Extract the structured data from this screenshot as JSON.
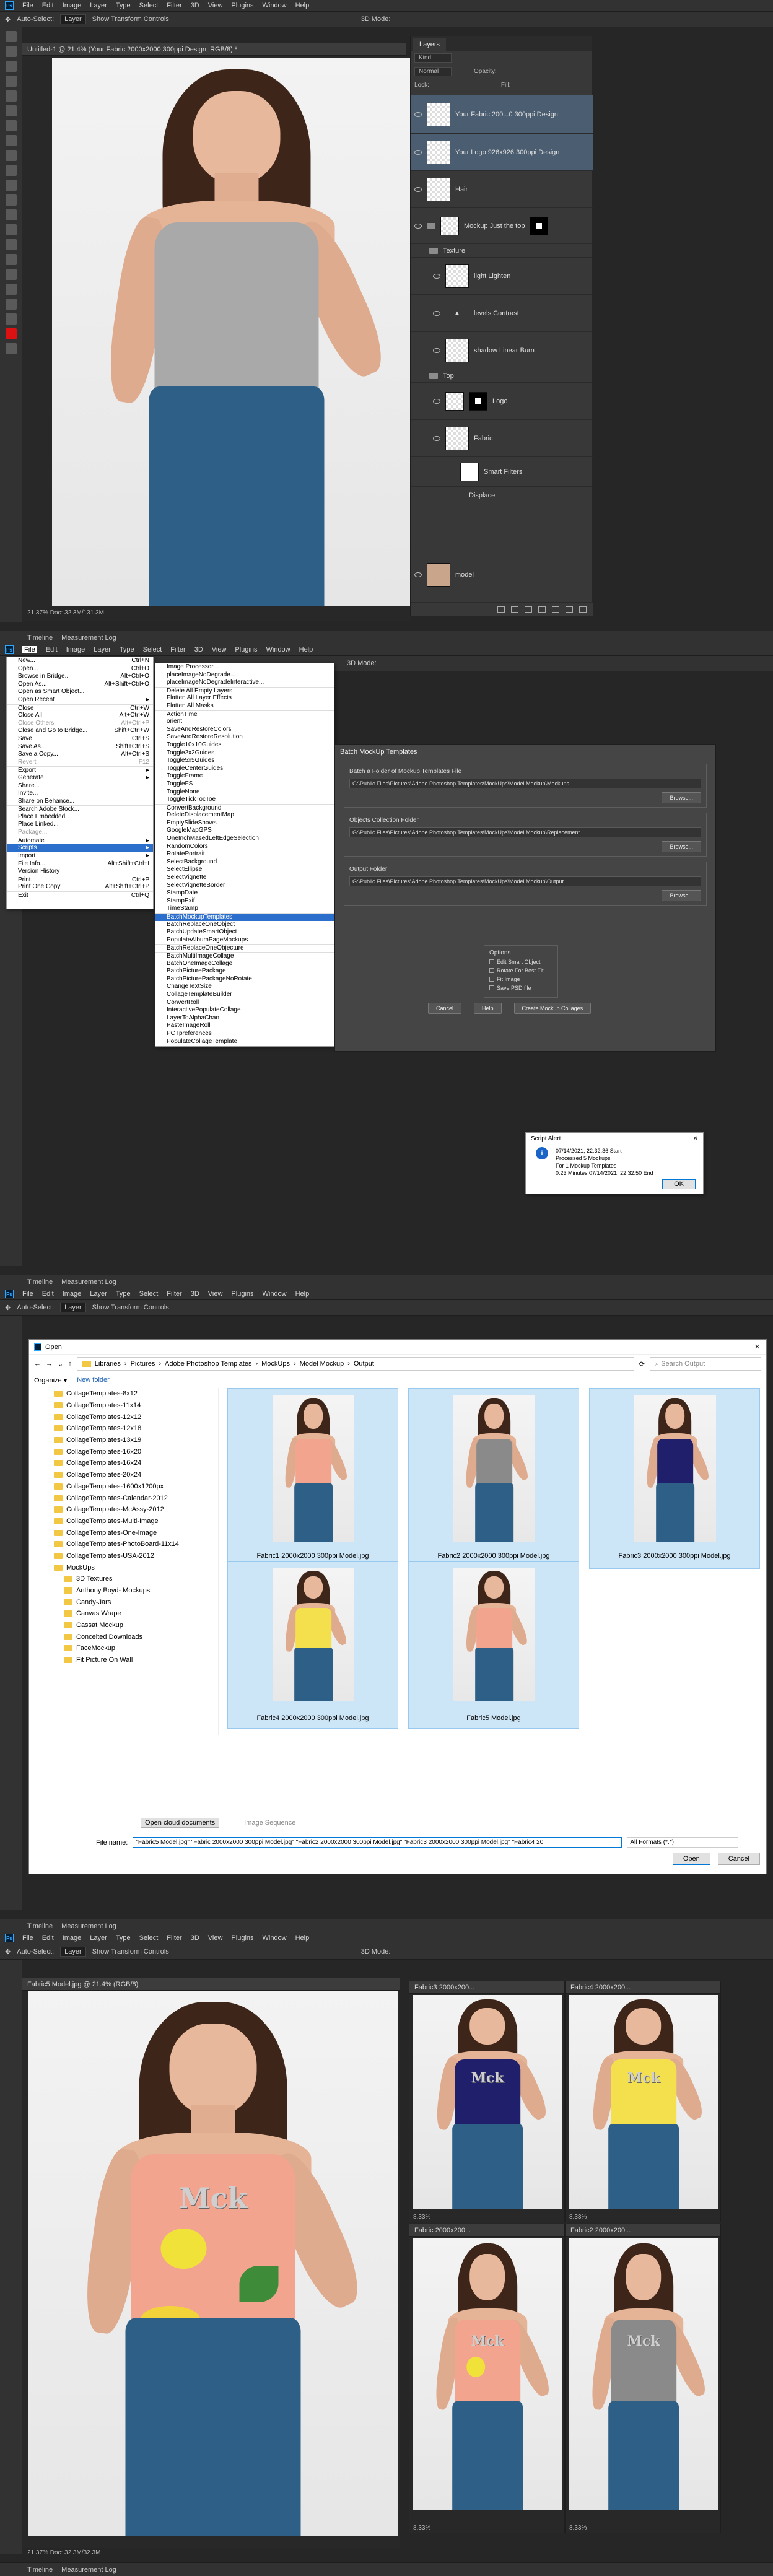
{
  "menubar": {
    "items": [
      "File",
      "Edit",
      "Image",
      "Layer",
      "Type",
      "Select",
      "Filter",
      "3D",
      "View",
      "Plugins",
      "Window",
      "Help"
    ]
  },
  "optbar": {
    "auto_select": "Auto-Select:",
    "auto_value": "Layer",
    "transform": "Show Transform Controls",
    "mode3d": "3D Mode:"
  },
  "timeline": {
    "tab1": "Timeline",
    "tab2": "Measurement Log"
  },
  "panel1": {
    "doc_title": "Untitled-1 @ 21.4% (Your Fabric 2000x2000 300ppi Design, RGB/8) *",
    "status": "21.37%     Doc: 32.3M/131.3M",
    "top_color": "#a9a9a9",
    "layers": {
      "tab": "Layers",
      "kind": "Kind",
      "blend": "Normal",
      "opacity_label": "Opacity:",
      "lock_label": "Lock:",
      "fill_label": "Fill:",
      "items": [
        {
          "name": "Your Fabric 200...0 300ppi Design"
        },
        {
          "name": "Your Logo 926x926 300ppi Design"
        },
        {
          "name": "Hair"
        },
        {
          "name": "Mockup  Just the top"
        },
        {
          "name": "Texture"
        },
        {
          "name": "light Lighten"
        },
        {
          "name": "levels Contrast"
        },
        {
          "name": "shadow Linear Burn"
        },
        {
          "name": "Top"
        },
        {
          "name": "Logo"
        },
        {
          "name": "Fabric"
        },
        {
          "name": "Smart Filters"
        },
        {
          "name": "Displace"
        },
        {
          "name": "model"
        }
      ]
    }
  },
  "panel2": {
    "file_menu": [
      {
        "label": "New...",
        "key": "Ctrl+N"
      },
      {
        "label": "Open...",
        "key": "Ctrl+O"
      },
      {
        "label": "Browse in Bridge...",
        "key": "Alt+Ctrl+O"
      },
      {
        "label": "Open As...",
        "key": "Alt+Shift+Ctrl+O"
      },
      {
        "label": "Open as Smart Object...",
        "key": ""
      },
      {
        "label": "Open Recent",
        "key": "▸"
      },
      {
        "label": "Close",
        "key": "Ctrl+W"
      },
      {
        "label": "Close All",
        "key": "Alt+Ctrl+W"
      },
      {
        "label": "Close Others",
        "key": "Alt+Ctrl+P"
      },
      {
        "label": "Close and Go to Bridge...",
        "key": "Shift+Ctrl+W"
      },
      {
        "label": "Save",
        "key": "Ctrl+S"
      },
      {
        "label": "Save As...",
        "key": "Shift+Ctrl+S"
      },
      {
        "label": "Save a Copy...",
        "key": "Alt+Ctrl+S"
      },
      {
        "label": "Revert",
        "key": "F12"
      },
      {
        "label": "Export",
        "key": "▸"
      },
      {
        "label": "Generate",
        "key": "▸"
      },
      {
        "label": "Share...",
        "key": ""
      },
      {
        "label": "Invite...",
        "key": ""
      },
      {
        "label": "Share on Behance...",
        "key": ""
      },
      {
        "label": "Search Adobe Stock...",
        "key": ""
      },
      {
        "label": "Place Embedded...",
        "key": ""
      },
      {
        "label": "Place Linked...",
        "key": ""
      },
      {
        "label": "Package...",
        "key": ""
      },
      {
        "label": "Automate",
        "key": "▸"
      },
      {
        "label": "Scripts",
        "key": "▸"
      },
      {
        "label": "Import",
        "key": "▸"
      },
      {
        "label": "File Info...",
        "key": "Alt+Shift+Ctrl+I"
      },
      {
        "label": "Version History",
        "key": ""
      },
      {
        "label": "Print...",
        "key": "Ctrl+P"
      },
      {
        "label": "Print One Copy",
        "key": "Alt+Shift+Ctrl+P"
      },
      {
        "label": "Exit",
        "key": "Ctrl+Q"
      }
    ],
    "scripts_menu": [
      "Image Processor...",
      "placeImageNoDegrade...",
      "placeImageNoDegradeInteractive...",
      "Delete All Empty Layers",
      "Flatten All Layer Effects",
      "Flatten All Masks",
      "ActionTime",
      "orient",
      "SaveAndRestoreColors",
      "SaveAndRestoreResolution",
      "Toggle10x10Guides",
      "Toggle2x2Guides",
      "Toggle5x5Guides",
      "ToggleCenterGuides",
      "ToggleFrame",
      "ToggleFS",
      "ToggleNone",
      "ToggleTickTocToe",
      "ConvertBackground",
      "DeleteDisplacementMap",
      "EmptySlideShows",
      "GoogleMapGPS",
      "OneInchMasedLeftEdgeSelection",
      "RandomColors",
      "RotatePortrait",
      "SelectBackground",
      "SelectEllipse",
      "SelectVignette",
      "SelectVignetteBorder",
      "StampDate",
      "StampExif",
      "TimeStamp",
      "BatchMockupTemplates",
      "BatchReplaceOneObject",
      "BatchUpdateSmartObject",
      "PopulateAlbumPageMockups",
      "BatchReplaceOneObjecture",
      "BatchMultiImageCollage",
      "BatchOneImageCollage",
      "BatchPicturePackage",
      "BatchPicturePackageNoRotate",
      "ChangeTextSize",
      "CollageTemplateBuilder",
      "ConvertRoll",
      "InteractivePopulateCollage",
      "LayerToAlphaChan",
      "PasteImageRoll",
      "PCTpreferences",
      "PopulateCollageTemplate"
    ],
    "batch": {
      "title": "Batch MockUp Templates",
      "g1": "Batch a Folder of Mockup Templates File",
      "p1": "G:\\Public Files\\Pictures\\Adobe Photoshop Templates\\MockUps\\Model Mockup\\Mockups",
      "g2": "Objects Collection Folder",
      "p2": "G:\\Public Files\\Pictures\\Adobe Photoshop Templates\\MockUps\\Model Mockup\\Replacement",
      "g3": "Output Folder",
      "p3": "G:\\Public Files\\Pictures\\Adobe Photoshop Templates\\MockUps\\Model Mockup\\Output",
      "browse": "Browse...",
      "g4": "Options",
      "o1": "Edit Smart Object",
      "o2": "Rotate For Best Fit",
      "o3": "Fit Image",
      "o4": "Save PSD file",
      "cancel": "Cancel",
      "help": "Help",
      "create": "Create Mockup Collages"
    },
    "alert": {
      "title": "Script Alert",
      "l1": "07/14/2021, 22:32:36 Start",
      "l2": "Processed 5 Mockups",
      "l3": "For 1 Mockup Templates",
      "l4": "0.23 Minutes 07/14/2021, 22:32:50  End",
      "ok": "OK"
    }
  },
  "panel3": {
    "title": "Open",
    "path": [
      "Libraries",
      "Pictures",
      "Adobe Photoshop Templates",
      "MockUps",
      "Model Mockup",
      "Output"
    ],
    "search": "Search Output",
    "organize": "Organize ▾",
    "new_folder": "New folder",
    "tree": [
      "CollageTemplates-8x12",
      "CollageTemplates-11x14",
      "CollageTemplates-12x12",
      "CollageTemplates-12x18",
      "CollageTemplates-13x19",
      "CollageTemplates-16x20",
      "CollageTemplates-16x24",
      "CollageTemplates-20x24",
      "CollageTemplates-1600x1200px",
      "CollageTemplates-Calendar-2012",
      "CollageTemplates-McAssy-2012",
      "CollageTemplates-Multi-Image",
      "CollageTemplates-One-Image",
      "CollageTemplates-PhotoBoard-11x14",
      "CollageTemplates-USA-2012",
      "MockUps",
      "3D Textures",
      "Anthony Boyd- Mockups",
      "Candy-Jars",
      "Canvas Wrape",
      "Cassat Mockup",
      "Conceited Downloads",
      "FaceMockup",
      "Fit Picture On Wall"
    ],
    "files": [
      {
        "name": "Fabric1 2000x2000 300ppi Model.jpg",
        "color": "#f2a48f"
      },
      {
        "name": "Fabric2 2000x2000 300ppi Model.jpg",
        "color": "#8a8a8a"
      },
      {
        "name": "Fabric3 2000x2000 300ppi Model.jpg",
        "color": "#1f1f6b"
      },
      {
        "name": "Fabric4 2000x2000 300ppi Model.jpg",
        "color": "#f4e04d"
      },
      {
        "name": "Fabric5 Model.jpg",
        "color": "#f2a48f"
      }
    ],
    "cloud": "Open cloud documents",
    "image_sequence": "Image Sequence",
    "filename_label": "File name:",
    "filename": "\"Fabric5 Model.jpg\" \"Fabric 2000x2000 300ppi Model.jpg\" \"Fabric2 2000x2000 300ppi Model.jpg\" \"Fabric3 2000x2000 300ppi Model.jpg\" \"Fabric4 20",
    "format": "All Formats (*.*)",
    "open": "Open",
    "cancel": "Cancel"
  },
  "panel4": {
    "main_title": "Fabric5 Model.jpg @ 21.4% (RGB/8)",
    "status": "21.37%     Doc: 32.3M/32.3M",
    "windows": [
      {
        "title": "Fabric3 2000x200...",
        "zoom": "8.33%",
        "color": "#1f1f6b"
      },
      {
        "title": "Fabric4 2000x200...",
        "zoom": "8.33%",
        "color": "#f4e04d"
      },
      {
        "title": "Fabric 2000x200...",
        "zoom": "8.33%",
        "color": "#f2a48f"
      },
      {
        "title": "Fabric2 2000x200...",
        "zoom": "8.33%",
        "color": "#8a8a8a"
      }
    ],
    "logo": "Mck"
  }
}
